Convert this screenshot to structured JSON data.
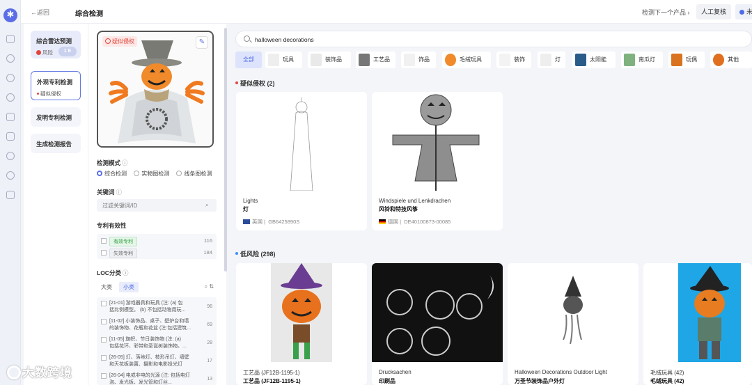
{
  "header": {
    "back_label": "←返回",
    "title": "综合检测",
    "next_label": "检测下一个产品 ›",
    "manual_review": "人工复核",
    "mark_label": "未"
  },
  "steps": [
    {
      "label": "综合雷达预测",
      "sub": "风险",
      "pill": "1 E"
    },
    {
      "label": "外观专利检测",
      "sub": "疑似侵权"
    },
    {
      "label": "发明专利检测"
    },
    {
      "label": "生成检测报告"
    }
  ],
  "product": {
    "tag": "疑似侵权"
  },
  "filters": {
    "mode_label": "检测模式",
    "modes": [
      "综合检测",
      "实物图检测",
      "线条图检测"
    ],
    "keyword_label": "关键词",
    "keyword_placeholder": "过滤关键词/ID",
    "validity_label": "专利有效性",
    "validity": [
      {
        "label": "有效专利",
        "count": "116"
      },
      {
        "label": "失效专利",
        "count": "184"
      }
    ],
    "loc_label": "LOC分类",
    "loc_tabs": [
      "大类",
      "小类"
    ],
    "loc_items": [
      {
        "line1": "[21-01] 游戏器具和玩具 (注: (a) 包",
        "line2": "括比例模型。 (b) 不包括动物用玩...",
        "count": "96"
      },
      {
        "line1": "[11-02] 小装饰品、桌子、壁炉台和墙",
        "line2": "的装饰物、花瓶和花盆 (注:包括建筑...",
        "count": "69"
      },
      {
        "line1": "[11-05] 旗帜、节日装饰物 (注: (a)",
        "line2": "包括花环、彩带和圣诞树装饰物。...",
        "count": "28"
      },
      {
        "line1": "[26-05] 灯、落地灯、枝形吊灯、墙壁",
        "line2": "和天花板装置、摄影和电影投光灯",
        "count": "17"
      },
      {
        "line1": "[26-04] 电或非电的光源 (注: 包括电灯",
        "line2": "泡、发光板、发光管和灯丝...",
        "count": "13"
      }
    ]
  },
  "search": {
    "query": "halloween decorations"
  },
  "categories": [
    "全部",
    "玩具",
    "装饰品",
    "工艺品",
    "饰品",
    "毛绒玩具",
    "装饰",
    "灯",
    "太阳能",
    "南瓜灯",
    "玩偶",
    "其他"
  ],
  "suspected": {
    "title": "疑似侵权 (2)",
    "items": [
      {
        "en": "Lights",
        "zh": "灯",
        "country": "英国",
        "id": "GB6425890S"
      },
      {
        "en": "Windspiele und Lenkdrachen",
        "zh": "风铃和特技风筝",
        "country": "德国",
        "id": "DE40100873-00085"
      }
    ]
  },
  "low_risk": {
    "title": "低风险 (298)",
    "items": [
      {
        "en": "工艺品 (JF12B-1195-1)",
        "zh": "工艺品 (JF12B-1195-1)"
      },
      {
        "en": "Drucksachen",
        "zh": "印刷品"
      },
      {
        "en": "Halloween Decorations Outdoor Light",
        "zh": "万圣节装饰品户外灯"
      },
      {
        "en": "毛绒玩具 (42)",
        "zh": "毛绒玩具 (42)"
      }
    ]
  },
  "watermark": "大数跨境",
  "colors": {
    "accent": "#5b6ee6",
    "risk_red": "#e04a3e",
    "low_blue": "#3f8cff"
  }
}
